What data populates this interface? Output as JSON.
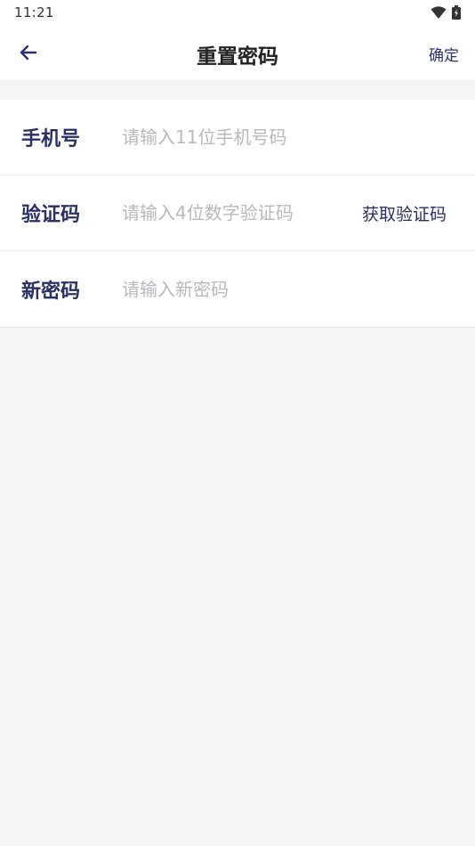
{
  "status_bar": {
    "time": "11:21",
    "icons": [
      "wifi-icon",
      "battery-charging-icon"
    ]
  },
  "app_bar": {
    "back_icon": "arrow-left-icon",
    "title": "重置密码",
    "confirm_label": "确定"
  },
  "form": {
    "phone": {
      "label": "手机号",
      "placeholder": "请输入11位手机号码",
      "value": ""
    },
    "code": {
      "label": "验证码",
      "placeholder": "请输入4位数字验证码",
      "value": "",
      "get_code_label": "获取验证码"
    },
    "new_password": {
      "label": "新密码",
      "placeholder": "请输入新密码",
      "value": ""
    }
  },
  "colors": {
    "accent": "#2a2f66",
    "background": "#f5f5f7",
    "placeholder": "#b8b8bf"
  }
}
